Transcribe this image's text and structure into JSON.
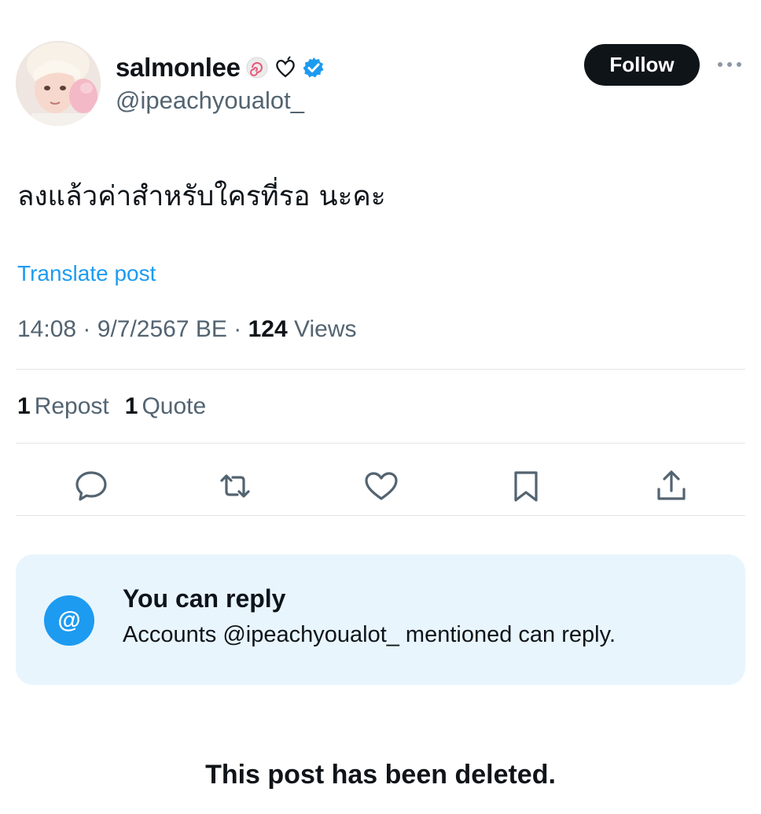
{
  "author": {
    "display_name": "salmonlee",
    "name_emojis": [
      "fish-cake-emoji",
      "heart-outline-emoji"
    ],
    "verified_badge": "verified-badge-icon",
    "handle": "@ipeachyoualot_"
  },
  "header": {
    "follow_label": "Follow",
    "more_icon": "more-horizontal-icon"
  },
  "post": {
    "text": "ลงแล้วค่าสำหรับใครที่รอ นะคะ",
    "translate_label": "Translate post",
    "time": "14:08",
    "date": "9/7/2567 BE",
    "separator": "·",
    "views_count": "124",
    "views_label": "Views"
  },
  "stats": {
    "reposts_count": "1",
    "reposts_label": "Repost",
    "quotes_count": "1",
    "quotes_label": "Quote"
  },
  "actions": [
    "reply-icon",
    "repost-icon",
    "like-icon",
    "bookmark-icon",
    "share-icon"
  ],
  "reply_restriction": {
    "icon_glyph": "@",
    "title": "You can reply",
    "description": "Accounts @ipeachyoualot_ mentioned can reply."
  },
  "deleted_notice": "This post has been deleted.",
  "colors": {
    "accent": "#1d9bf0",
    "text": "#0f1419",
    "muted": "#536471",
    "reply_box_bg": "#e8f5fd"
  }
}
